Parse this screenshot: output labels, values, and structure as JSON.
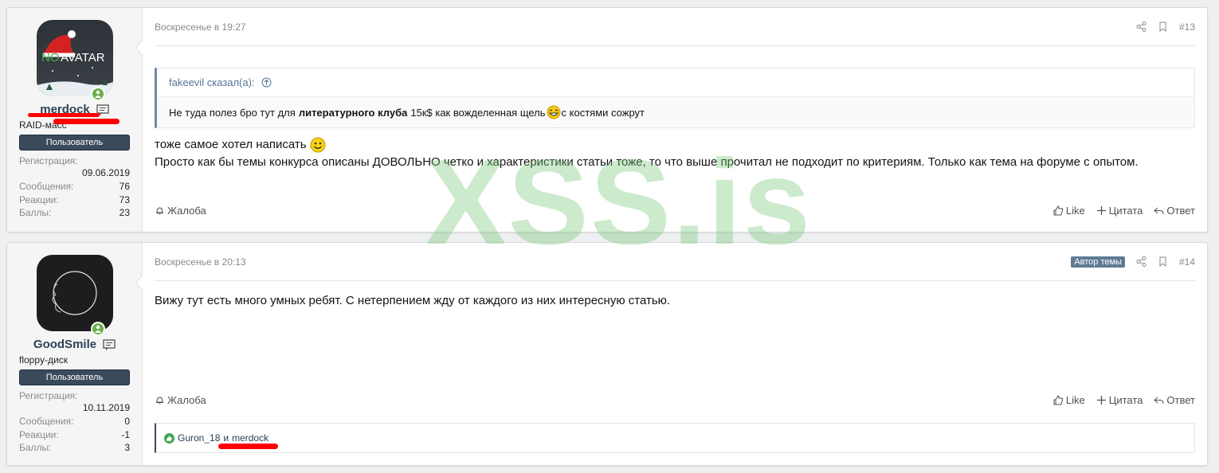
{
  "posts": [
    {
      "user": {
        "name": "merdock",
        "title": "RAID-масс",
        "badge": "Пользователь",
        "avatar_text_no": "NO",
        "avatar_text_av": "AVATAR",
        "registration_label": "Регистрация:",
        "registration_date": "09.06.2019",
        "messages_label": "Сообщения:",
        "messages": "76",
        "reactions_label": "Реакции:",
        "reactions": "73",
        "points_label": "Баллы:",
        "points": "23"
      },
      "date": "Воскресенье в 19:27",
      "number": "#13",
      "quote": {
        "author": "fakeevil сказал(а):",
        "text_before": "Не туда полез бро тут для",
        "text_bold": "литературного клуба",
        "text_after": "15к$ как вожделенная щель",
        "text_end": "с костями сожрут"
      },
      "message_line1": "тоже самое хотел написать",
      "message_line2": "Просто как бы темы конкурса описаны ДОВОЛЬНО четко и характеристики статьи тоже, то что выше прочитал не подходит по критериям. Только как тема на форуме с опытом.",
      "footer": {
        "report": "Жалоба",
        "like": "Like",
        "quote": "Цитата",
        "reply": "Ответ"
      }
    },
    {
      "user": {
        "name": "GoodSmile",
        "title": "floppy-диск",
        "badge": "Пользователь",
        "registration_label": "Регистрация:",
        "registration_date": "10.11.2019",
        "messages_label": "Сообщения:",
        "messages": "0",
        "reactions_label": "Реакции:",
        "reactions": "-1",
        "points_label": "Баллы:",
        "points": "3"
      },
      "date": "Воскресенье в 20:13",
      "author_badge": "Автор темы",
      "number": "#14",
      "message_line1": "Вижу тут есть много умных ребят. С нетерпением жду от каждого из них интересную статью.",
      "footer": {
        "report": "Жалоба",
        "like": "Like",
        "quote": "Цитата",
        "reply": "Ответ"
      },
      "likes": {
        "user1": "Guron_18",
        "conj": "и",
        "user2": "merdock"
      }
    }
  ],
  "watermark": "XSS.is",
  "colors": {
    "username": "#2b4258",
    "badge_bg": "#3a4a5c",
    "online": "#6ab04c",
    "quote_border": "#6d89a8",
    "redaction": "#ff0000"
  }
}
